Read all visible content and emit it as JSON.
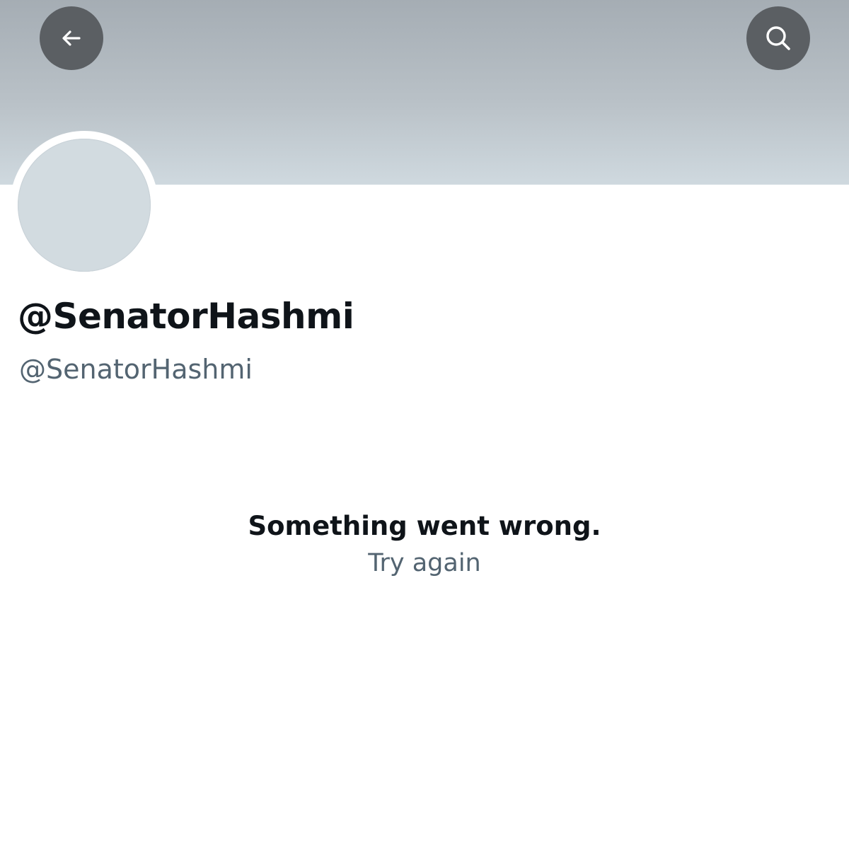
{
  "header": {
    "back_icon": "arrow-left-icon",
    "search_icon": "search-icon",
    "banner_color_top": "#a5adb4",
    "banner_color_bottom": "#cfd9df",
    "button_color": "#5b5f63"
  },
  "profile": {
    "display_name": "@SenatorHashmi",
    "handle": "@SenatorHashmi",
    "avatar_color": "#d2dbe0"
  },
  "error": {
    "title": "Something went wrong.",
    "retry_label": "Try again"
  }
}
